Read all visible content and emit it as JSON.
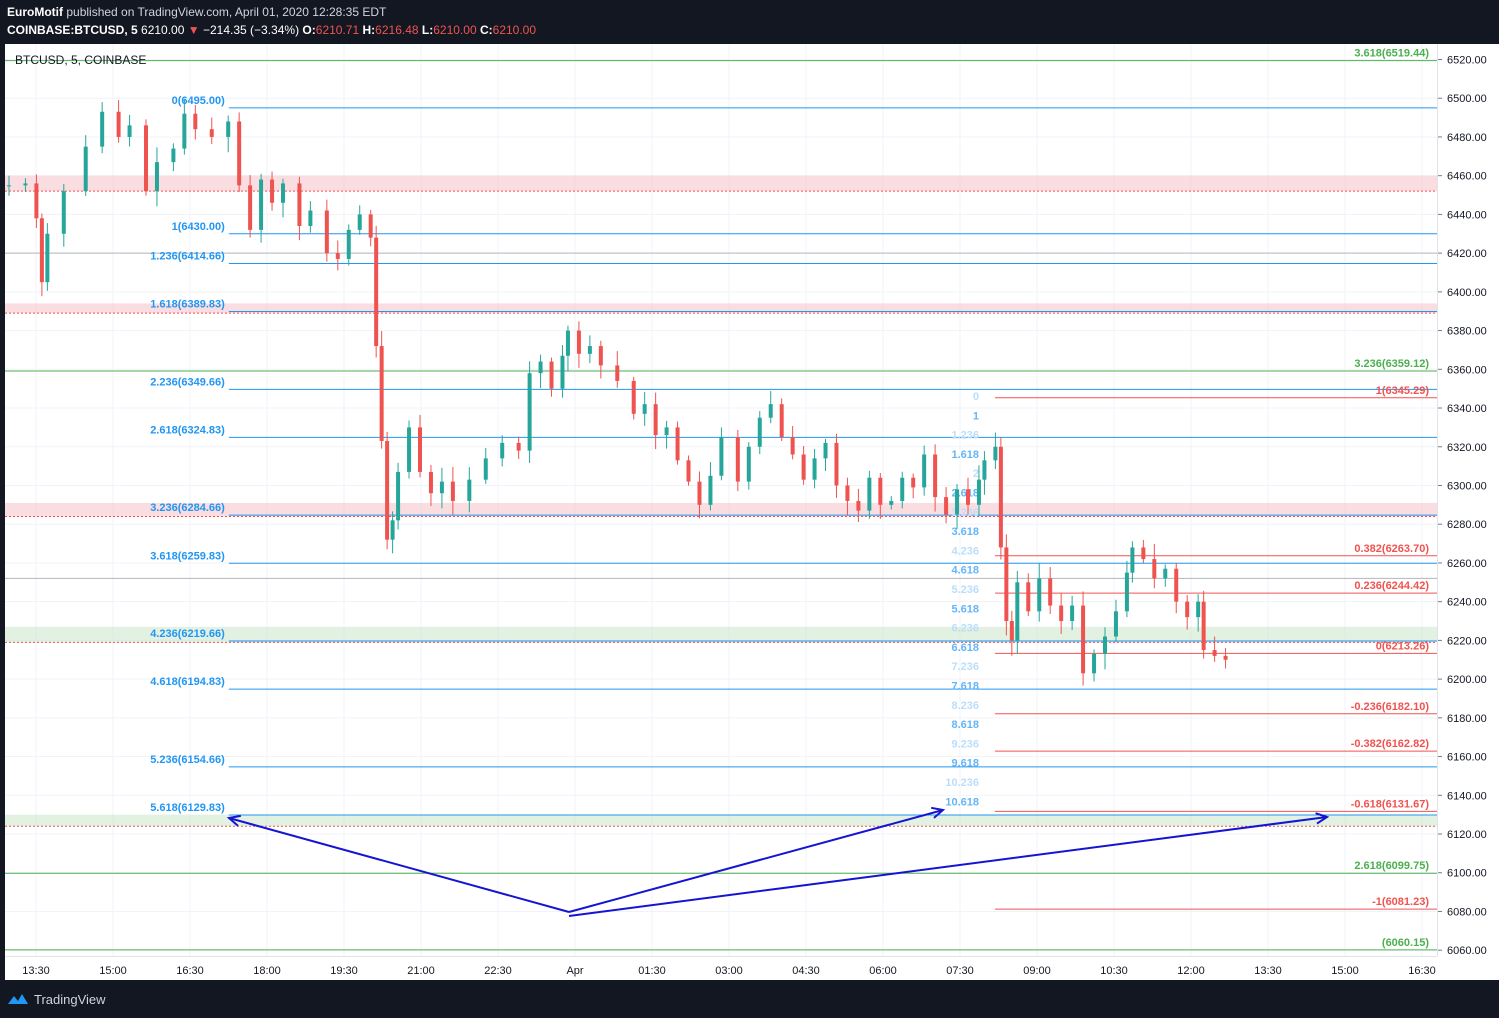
{
  "header": {
    "author": "EuroMotif",
    "published_text": "published on TradingView.com, April 01, 2020 12:28:35 EDT",
    "symbol_full": "COINBASE:BTCUSD, 5",
    "last_price": "6210.00",
    "change_arrow": "▼",
    "change": "−214.35 (−3.34%)",
    "o_label": "O:",
    "o_value": "6210.71",
    "h_label": "H:",
    "h_value": "6216.48",
    "l_label": "L:",
    "l_value": "6210.00",
    "c_label": "C:",
    "c_value": "6210.00"
  },
  "chart_data": {
    "type": "candlestick",
    "symbol_label": "BTCUSD, 5, COINBASE",
    "ylim": [
      6057,
      6528
    ],
    "price_ticks": [
      6520,
      6500,
      6480,
      6460,
      6440,
      6420,
      6400,
      6380,
      6360,
      6340,
      6320,
      6300,
      6280,
      6260,
      6240,
      6220,
      6200,
      6180,
      6160,
      6140,
      6120,
      6100,
      6080,
      6060
    ],
    "time_ticks": [
      "13:30",
      "15:00",
      "16:30",
      "18:00",
      "19:30",
      "21:00",
      "22:30",
      "Apr",
      "01:30",
      "03:00",
      "04:30",
      "06:00",
      "07:30",
      "09:00",
      "10:30",
      "12:00",
      "13:30",
      "15:00",
      "16:30"
    ],
    "colors": {
      "up": "#26a69a",
      "down": "#ef5350",
      "fib_blue": "#2196f3",
      "fib_red": "#ef5350",
      "fib_green": "#4caf50",
      "arrow": "#1414d2"
    },
    "price_path": [
      [
        0,
        6455
      ],
      [
        3,
        6456
      ],
      [
        5,
        6438
      ],
      [
        6,
        6405
      ],
      [
        7,
        6430
      ],
      [
        10,
        6452
      ],
      [
        14,
        6475
      ],
      [
        17,
        6493
      ],
      [
        20,
        6480
      ],
      [
        22,
        6486
      ],
      [
        25,
        6452
      ],
      [
        27,
        6467
      ],
      [
        30,
        6474
      ],
      [
        32,
        6492
      ],
      [
        34,
        6484
      ],
      [
        37,
        6480
      ],
      [
        40,
        6488
      ],
      [
        42,
        6455
      ],
      [
        44,
        6432
      ],
      [
        46,
        6458
      ],
      [
        48,
        6446
      ],
      [
        50,
        6456
      ],
      [
        53,
        6434
      ],
      [
        55,
        6442
      ],
      [
        58,
        6420
      ],
      [
        60,
        6417
      ],
      [
        62,
        6432
      ],
      [
        64,
        6440
      ],
      [
        66,
        6428
      ],
      [
        67,
        6372
      ],
      [
        68,
        6323
      ],
      [
        69,
        6272
      ],
      [
        70,
        6282
      ],
      [
        71,
        6307
      ],
      [
        73,
        6330
      ],
      [
        75,
        6307
      ],
      [
        77,
        6296
      ],
      [
        79,
        6302
      ],
      [
        81,
        6292
      ],
      [
        84,
        6303
      ],
      [
        87,
        6314
      ],
      [
        90,
        6322
      ],
      [
        93,
        6318
      ],
      [
        95,
        6358
      ],
      [
        97,
        6364
      ],
      [
        99,
        6350
      ],
      [
        101,
        6367
      ],
      [
        102,
        6380
      ],
      [
        104,
        6368
      ],
      [
        106,
        6372
      ],
      [
        108,
        6362
      ],
      [
        111,
        6354
      ],
      [
        114,
        6337
      ],
      [
        116,
        6342
      ],
      [
        118,
        6326
      ],
      [
        120,
        6330
      ],
      [
        122,
        6313
      ],
      [
        124,
        6302
      ],
      [
        126,
        6290
      ],
      [
        128,
        6305
      ],
      [
        130,
        6325
      ],
      [
        133,
        6302
      ],
      [
        135,
        6320
      ],
      [
        137,
        6335
      ],
      [
        139,
        6342
      ],
      [
        141,
        6325
      ],
      [
        143,
        6316
      ],
      [
        145,
        6303
      ],
      [
        147,
        6314
      ],
      [
        149,
        6322
      ],
      [
        151,
        6300
      ],
      [
        153,
        6292
      ],
      [
        155,
        6287
      ],
      [
        157,
        6304
      ],
      [
        159,
        6290
      ],
      [
        161,
        6292
      ],
      [
        163,
        6304
      ],
      [
        165,
        6299
      ],
      [
        167,
        6316
      ],
      [
        169,
        6294
      ],
      [
        171,
        6285
      ],
      [
        173,
        6298
      ],
      [
        175,
        6290
      ],
      [
        177,
        6303
      ],
      [
        178,
        6313
      ],
      [
        180,
        6320
      ],
      [
        181,
        6268
      ],
      [
        182,
        6230
      ],
      [
        183,
        6220
      ],
      [
        184,
        6250
      ],
      [
        186,
        6235
      ],
      [
        188,
        6252
      ],
      [
        190,
        6238
      ],
      [
        192,
        6230
      ],
      [
        194,
        6238
      ],
      [
        196,
        6203
      ],
      [
        198,
        6213
      ],
      [
        200,
        6222
      ],
      [
        202,
        6235
      ],
      [
        204,
        6255
      ],
      [
        205,
        6268
      ],
      [
        207,
        6262
      ],
      [
        209,
        6252
      ],
      [
        211,
        6257
      ],
      [
        213,
        6240
      ],
      [
        215,
        6232
      ],
      [
        217,
        6240
      ],
      [
        218,
        6215
      ],
      [
        220,
        6212
      ],
      [
        222,
        6210
      ]
    ],
    "fib_levels": [
      {
        "label": "0(6495.00)",
        "price": 6495.0,
        "color": "#2196f3",
        "x0": 0.1563
      },
      {
        "label": "1(6430.00)",
        "price": 6430.0,
        "color": "#2196f3",
        "x0": 0.1563
      },
      {
        "label": "1.236(6414.66)",
        "price": 6414.66,
        "color": "#2196f3",
        "x0": 0.1563
      },
      {
        "label": "1.618(6389.83)",
        "price": 6389.83,
        "color": "#2196f3",
        "x0": 0.1563
      },
      {
        "label": "2.236(6349.66)",
        "price": 6349.66,
        "color": "#2196f3",
        "x0": 0.1563
      },
      {
        "label": "2.618(6324.83)",
        "price": 6324.83,
        "color": "#2196f3",
        "x0": 0.1563
      },
      {
        "label": "3.236(6284.66)",
        "price": 6284.66,
        "color": "#2196f3",
        "x0": 0.1563
      },
      {
        "label": "3.618(6259.83)",
        "price": 6259.83,
        "color": "#2196f3",
        "x0": 0.1563
      },
      {
        "label": "4.236(6219.66)",
        "price": 6219.66,
        "color": "#2196f3",
        "x0": 0.1563
      },
      {
        "label": "4.618(6194.83)",
        "price": 6194.83,
        "color": "#2196f3",
        "x0": 0.1563
      },
      {
        "label": "5.236(6154.66)",
        "price": 6154.66,
        "color": "#2196f3",
        "x0": 0.1563
      },
      {
        "label": "5.618(6129.83)",
        "price": 6129.83,
        "color": "#2196f3",
        "x0": 0.1563
      },
      {
        "label": "1(6345.29)",
        "price": 6345.29,
        "color": "#ef5350",
        "x0": 0.6913
      },
      {
        "label": "0.382(6263.70)",
        "price": 6263.7,
        "color": "#ef5350",
        "x0": 0.6913
      },
      {
        "label": "0.236(6244.42)",
        "price": 6244.42,
        "color": "#ef5350",
        "x0": 0.6913
      },
      {
        "label": "0(6213.26)",
        "price": 6213.26,
        "color": "#ef5350",
        "x0": 0.6913
      },
      {
        "label": "-0.236(6182.10)",
        "price": 6182.1,
        "color": "#ef5350",
        "x0": 0.6913
      },
      {
        "label": "-0.382(6162.82)",
        "price": 6162.82,
        "color": "#ef5350",
        "x0": 0.6913
      },
      {
        "label": "-0.618(6131.67)",
        "price": 6131.67,
        "color": "#ef5350",
        "x0": 0.6913
      },
      {
        "label": "-1(6081.23)",
        "price": 6081.23,
        "color": "#ef5350",
        "x0": 0.6913
      },
      {
        "label": "3.618(6519.44)",
        "price": 6519.44,
        "color": "#4caf50",
        "x0": 0
      },
      {
        "label": "3.236(6359.12)",
        "price": 6359.12,
        "color": "#4caf50",
        "x0": 0
      },
      {
        "label": "2.618(6099.75)",
        "price": 6099.75,
        "color": "#4caf50",
        "x0": 0
      },
      {
        "label": "(6060.15)",
        "price": 6060.15,
        "color": "#4caf50",
        "x0": 0
      }
    ],
    "fib_ext_labels": [
      "0",
      "1",
      "1.236",
      "1.618",
      "2",
      "2.618",
      "3.236",
      "3.618",
      "4.236",
      "4.618",
      "5.236",
      "5.618",
      "6.236",
      "6.618",
      "7.236",
      "7.618",
      "8.236",
      "8.618",
      "9.236",
      "9.618",
      "10.236",
      "10.618"
    ],
    "zones": [
      {
        "top": 6460,
        "bottom": 6452,
        "color": "#f7c6cd"
      },
      {
        "top": 6394,
        "bottom": 6389,
        "color": "#f7c6cd"
      },
      {
        "top": 6291,
        "bottom": 6284,
        "color": "#f7c6cd"
      },
      {
        "top": 6227,
        "bottom": 6219,
        "color": "#cfe8cf"
      },
      {
        "top": 6130,
        "bottom": 6124,
        "color": "#cfe8cf"
      }
    ],
    "gray_lines": [
      6420,
      6252
    ]
  }
}
